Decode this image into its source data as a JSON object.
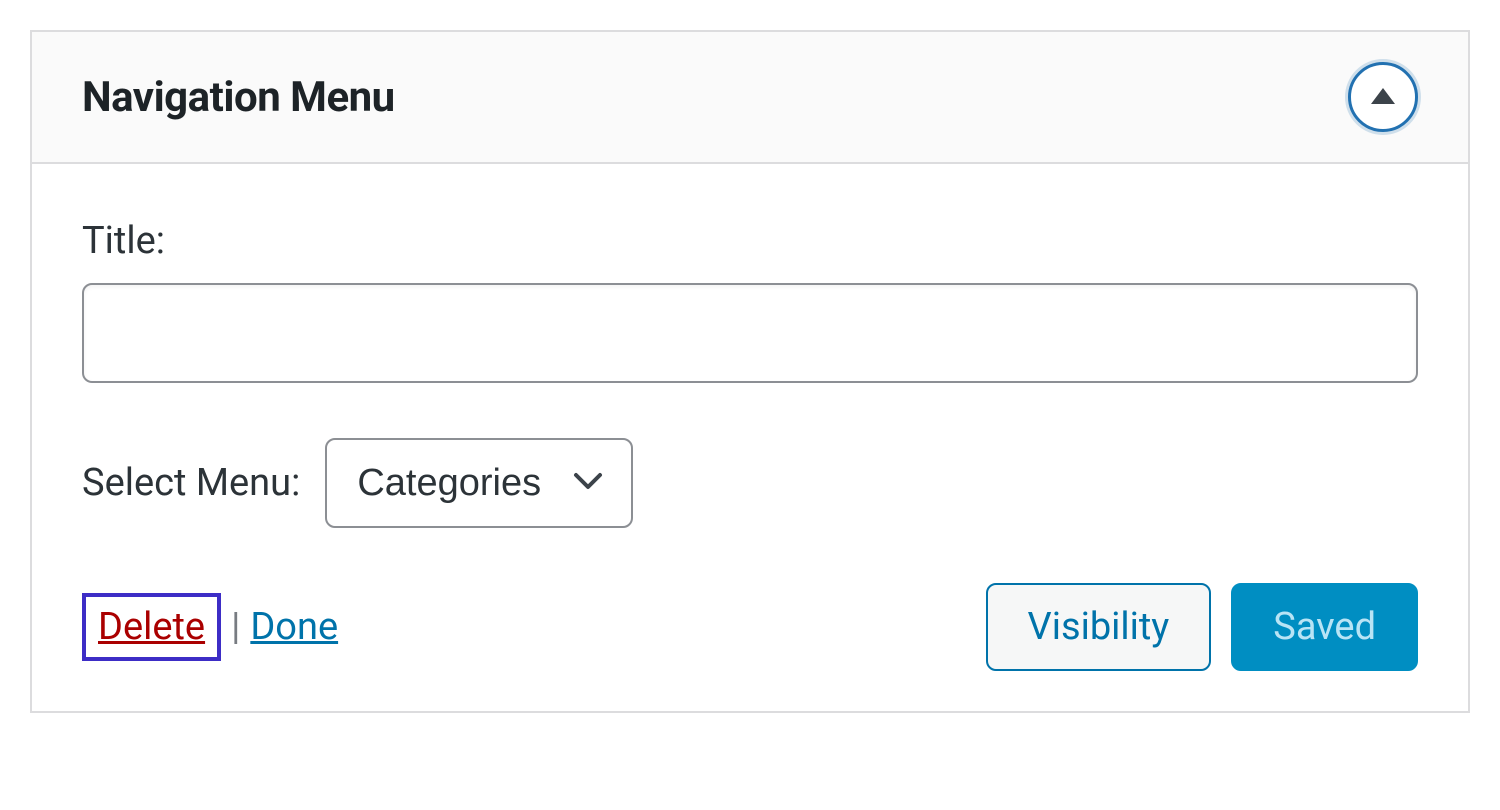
{
  "widget": {
    "title": "Navigation Menu"
  },
  "form": {
    "title_label": "Title:",
    "title_value": "",
    "select_menu_label": "Select Menu:",
    "select_menu_value": "Categories"
  },
  "actions": {
    "delete_label": "Delete",
    "separator": "|",
    "done_label": "Done",
    "visibility_label": "Visibility",
    "saved_label": "Saved"
  },
  "colors": {
    "accent": "#2271b1",
    "danger": "#a00",
    "link": "#0073aa",
    "primary_button": "#008ec2",
    "highlight_border": "#3d2dc6"
  }
}
